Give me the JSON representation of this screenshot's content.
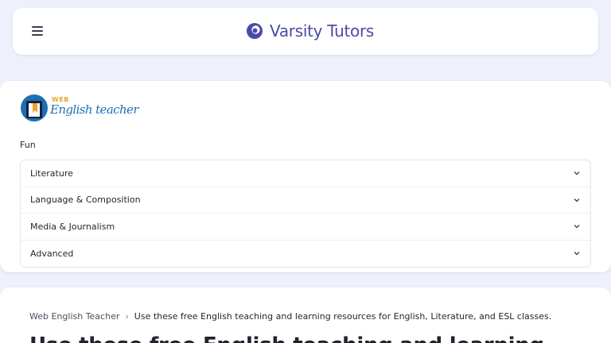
{
  "header": {
    "brand_name": "Varsity Tutors",
    "brand_color": "#4b4aa8"
  },
  "site_logo": {
    "web": "WEB",
    "english_teacher": "English teacher"
  },
  "menu": {
    "category_label": "Fun",
    "items": [
      {
        "label": "Literature"
      },
      {
        "label": "Language & Composition"
      },
      {
        "label": "Media & Journalism"
      },
      {
        "label": "Advanced"
      }
    ]
  },
  "breadcrumb": {
    "home": "Web English Teacher",
    "current": "Use these free English teaching and learning resources for English, Literature, and ESL classes."
  },
  "main": {
    "heading": "Use these free English teaching and learning"
  }
}
